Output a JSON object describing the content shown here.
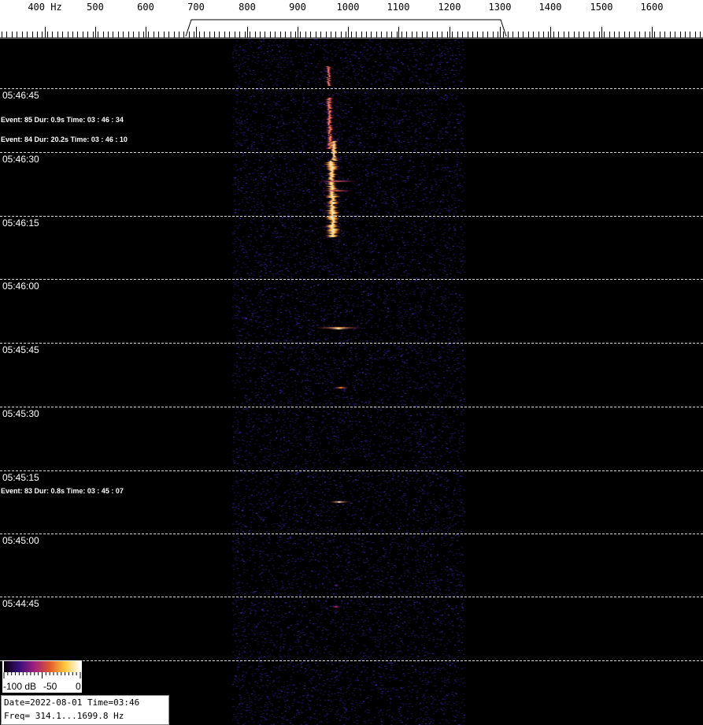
{
  "ruler": {
    "unit": "Hz",
    "ticks": [
      "400",
      "500",
      "600",
      "700",
      "800",
      "900",
      "1000",
      "1100",
      "1200",
      "1300",
      "1400",
      "1500",
      "1600"
    ]
  },
  "time_labels": [
    "05:46:45",
    "05:46:30",
    "05:46:15",
    "05:46:00",
    "05:45:45",
    "05:45:30",
    "05:45:15",
    "05:45:00",
    "05:44:45"
  ],
  "events": [
    "Event: 85  Dur:  0.9s  Time:  03 : 46 : 34",
    "Event: 84  Dur:  20.2s  Time:  03 : 46 : 10",
    "Event: 83  Dur:  0.8s  Time:  03 : 45 : 07"
  ],
  "colorbar": {
    "labels": [
      "-100 dB",
      "-50",
      "0"
    ],
    "colors": [
      "#0a0010",
      "#3b0d7a",
      "#a0207a",
      "#e05a2a",
      "#ffc83c",
      "#ffffff"
    ]
  },
  "info": {
    "date_line": "Date=2022-08-01 Time=03:46",
    "freq_line": "Freq= 314.1...1699.8 Hz"
  }
}
